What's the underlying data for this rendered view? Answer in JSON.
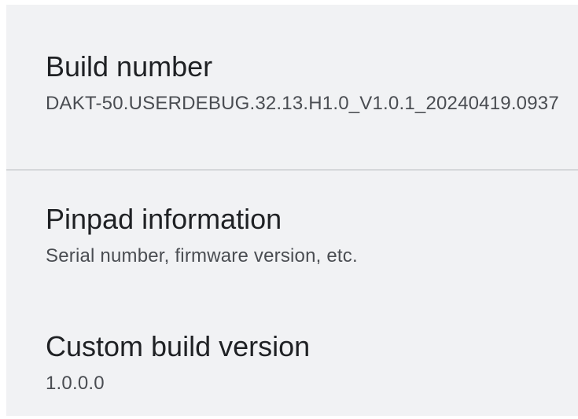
{
  "settings": {
    "items": [
      {
        "title": "Build number",
        "summary": "DAKT-50.USERDEBUG.32.13.H1.0_V1.0.1_20240419.0937"
      },
      {
        "title": "Pinpad information",
        "summary": "Serial number, firmware version, etc."
      },
      {
        "title": "Custom build version",
        "summary": "1.0.0.0"
      }
    ]
  }
}
